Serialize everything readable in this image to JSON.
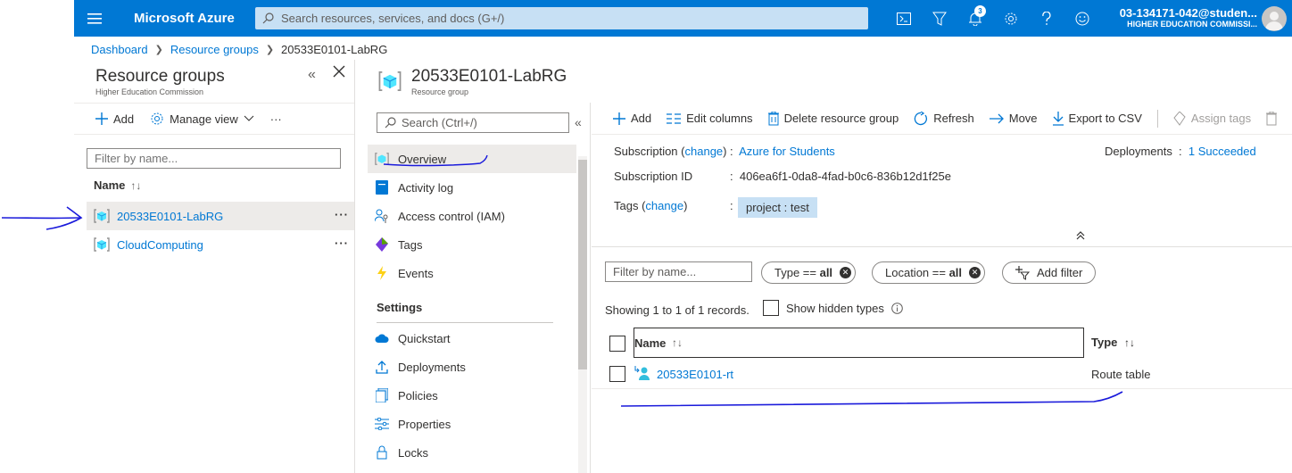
{
  "topbar": {
    "brand": "Microsoft Azure",
    "search_placeholder": "Search resources, services, and docs (G+/)",
    "notification_count": "3",
    "account_name": "03-134171-042@studen...",
    "account_org": "HIGHER EDUCATION COMMISSI..."
  },
  "breadcrumb": {
    "items": [
      "Dashboard",
      "Resource groups",
      "20533E0101-LabRG"
    ]
  },
  "left_blade": {
    "title": "Resource groups",
    "subtitle": "Higher Education Commission",
    "add_label": "Add",
    "manage_view_label": "Manage view",
    "filter_placeholder": "Filter by name...",
    "column_name": "Name",
    "rows": [
      {
        "name": "20533E0101-LabRG",
        "selected": true
      },
      {
        "name": "CloudComputing",
        "selected": false
      }
    ]
  },
  "header": {
    "title": "20533E0101-LabRG",
    "subtitle": "Resource group"
  },
  "resource_menu": {
    "search_placeholder": "Search (Ctrl+/)",
    "items": [
      {
        "label": "Overview",
        "icon": "resource-group-icon"
      },
      {
        "label": "Activity log",
        "icon": "activity-log-icon"
      },
      {
        "label": "Access control (IAM)",
        "icon": "iam-icon"
      },
      {
        "label": "Tags",
        "icon": "tag-icon"
      },
      {
        "label": "Events",
        "icon": "lightning-icon"
      }
    ],
    "settings_section": "Settings",
    "settings_items": [
      {
        "label": "Quickstart",
        "icon": "cloud-icon"
      },
      {
        "label": "Deployments",
        "icon": "upload-icon"
      },
      {
        "label": "Policies",
        "icon": "policies-icon"
      },
      {
        "label": "Properties",
        "icon": "properties-icon"
      },
      {
        "label": "Locks",
        "icon": "lock-icon"
      }
    ]
  },
  "toolbar": {
    "add": "Add",
    "edit_columns": "Edit columns",
    "delete": "Delete resource group",
    "refresh": "Refresh",
    "move": "Move",
    "export": "Export to CSV",
    "assign_tags": "Assign tags"
  },
  "essentials": {
    "subscription_label": "Subscription",
    "change": "change",
    "subscription_value": "Azure for Students",
    "subscription_id_label": "Subscription ID",
    "subscription_id": "406ea6f1-0da8-4fad-b0c6-836b12d1f25e",
    "tags_label": "Tags",
    "tag_value": "project : test",
    "deployments_label": "Deployments",
    "deployments_value": "1 Succeeded",
    "colon": ":"
  },
  "resources": {
    "filter_placeholder": "Filter by name...",
    "type_pill_prefix": "Type == ",
    "type_pill_value": "all",
    "location_pill_prefix": "Location == ",
    "location_pill_value": "all",
    "add_filter": "Add filter",
    "showing": "Showing 1 to 1 of 1 records.",
    "show_hidden": "Show hidden types",
    "col_name": "Name",
    "col_type": "Type",
    "rows": [
      {
        "name": "20533E0101-rt",
        "type": "Route table"
      }
    ]
  },
  "colors": {
    "brand_blue": "#0078d4",
    "annotation_blue": "#0000cc",
    "search_bg": "#c7e0f4"
  }
}
